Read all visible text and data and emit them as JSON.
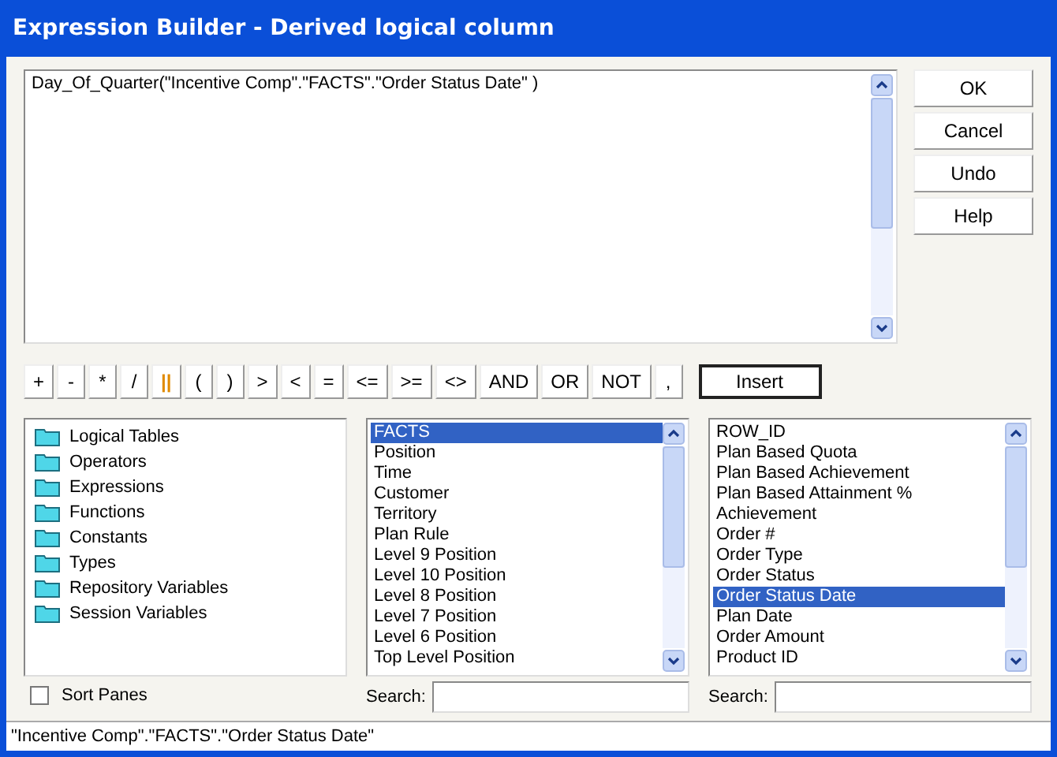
{
  "window": {
    "title": "Expression Builder - Derived logical column"
  },
  "expression": {
    "value": "Day_Of_Quarter(\"Incentive Comp\".\"FACTS\".\"Order Status Date\" )"
  },
  "buttons": [
    "OK",
    "Cancel",
    "Undo",
    "Help"
  ],
  "operators": [
    {
      "label": "+",
      "kind": "op"
    },
    {
      "label": "-",
      "kind": "op"
    },
    {
      "label": "*",
      "kind": "op"
    },
    {
      "label": "/",
      "kind": "op"
    },
    {
      "label": "||",
      "kind": "concat"
    },
    {
      "label": "(",
      "kind": "op"
    },
    {
      "label": ")",
      "kind": "op"
    },
    {
      "label": ">",
      "kind": "op"
    },
    {
      "label": "<",
      "kind": "op"
    },
    {
      "label": "=",
      "kind": "op"
    },
    {
      "label": "<=",
      "kind": "op"
    },
    {
      "label": ">=",
      "kind": "op"
    },
    {
      "label": "<>",
      "kind": "op"
    },
    {
      "label": "AND",
      "kind": "op"
    },
    {
      "label": "OR",
      "kind": "op"
    },
    {
      "label": "NOT",
      "kind": "op"
    },
    {
      "label": ",",
      "kind": "op"
    }
  ],
  "insert_button": "Insert",
  "categories": [
    "Logical Tables",
    "Operators",
    "Expressions",
    "Functions",
    "Constants",
    "Types",
    "Repository Variables",
    "Session Variables"
  ],
  "tables": [
    {
      "label": "FACTS",
      "selected": true
    },
    {
      "label": "Position",
      "selected": false
    },
    {
      "label": "Time",
      "selected": false
    },
    {
      "label": "Customer",
      "selected": false
    },
    {
      "label": "Territory",
      "selected": false
    },
    {
      "label": "Plan Rule",
      "selected": false
    },
    {
      "label": "Level 9 Position",
      "selected": false
    },
    {
      "label": "Level 10 Position",
      "selected": false
    },
    {
      "label": "Level 8 Position",
      "selected": false
    },
    {
      "label": "Level 7 Position",
      "selected": false
    },
    {
      "label": "Level 6 Position",
      "selected": false
    },
    {
      "label": "Top Level Position",
      "selected": false
    }
  ],
  "columns": [
    {
      "label": "ROW_ID",
      "selected": false
    },
    {
      "label": "Plan Based Quota",
      "selected": false
    },
    {
      "label": "Plan Based Achievement",
      "selected": false
    },
    {
      "label": "Plan Based Attainment %",
      "selected": false
    },
    {
      "label": "Achievement",
      "selected": false
    },
    {
      "label": "Order #",
      "selected": false
    },
    {
      "label": "Order Type",
      "selected": false
    },
    {
      "label": "Order Status",
      "selected": false
    },
    {
      "label": "Order Status Date",
      "selected": true
    },
    {
      "label": "Plan Date",
      "selected": false
    },
    {
      "label": "Order Amount",
      "selected": false
    },
    {
      "label": "Product ID",
      "selected": false
    }
  ],
  "sort_panes": {
    "label": "Sort Panes",
    "checked": false
  },
  "search_label_1": "Search:",
  "search_label_2": "Search:",
  "status_bar": "\"Incentive Comp\".\"FACTS\".\"Order Status Date\""
}
